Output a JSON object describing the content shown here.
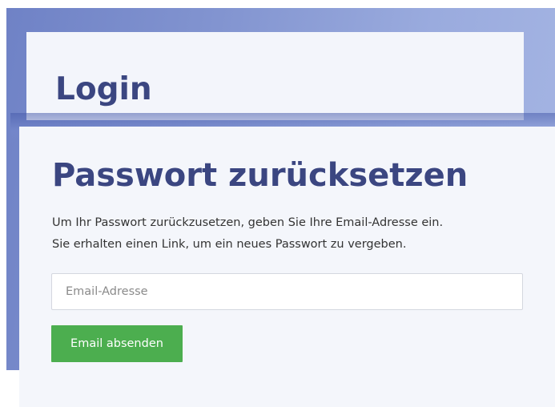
{
  "login": {
    "title": "Login"
  },
  "reset_modal": {
    "title": "Passwort zurücksetzen",
    "description_line1": "Um Ihr Passwort zurückzusetzen, geben Sie Ihre Email-Adresse ein.",
    "description_line2": "Sie erhalten einen Link, um ein neues Passwort zu vergeben.",
    "email_placeholder": "Email-Adresse",
    "email_value": "",
    "submit_label": "Email absenden"
  },
  "colors": {
    "heading": "#3b4681",
    "button": "#4cae4f",
    "backdrop": "#8294d0"
  }
}
